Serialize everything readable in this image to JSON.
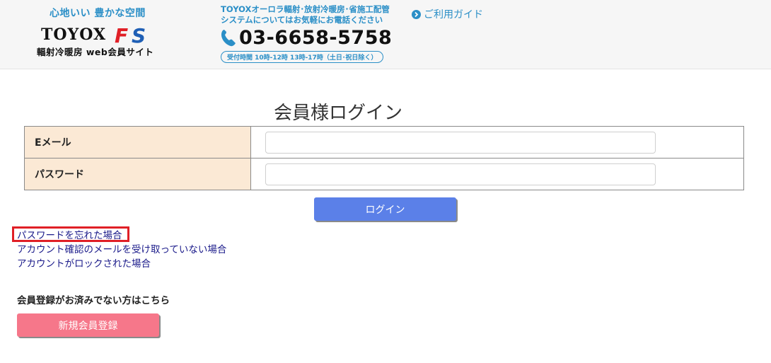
{
  "header": {
    "tagline": "心地いい 豊かな空間",
    "brand": "TOYOX",
    "brand_mark": "FS",
    "subbrand": "輻射冷暖房 web会員サイト",
    "contact_line1": "TOYOXオーロラ輻射･放射冷暖房･省施工配管",
    "contact_line2": "システムについてはお気軽にお電話ください",
    "phone": "03-6658-5758",
    "hours": "受付時間 10時-12時 13時-17時（土日･祝日除く）",
    "guide_label": "ご利用ガイド"
  },
  "login": {
    "title": "会員様ログイン",
    "email_label": "Eメール",
    "email_value": "",
    "password_label": "パスワード",
    "password_value": "",
    "submit_label": "ログイン"
  },
  "links": {
    "forgot_password": "パスワードを忘れた場合",
    "confirmation_not_received": "アカウント確認のメールを受け取っていない場合",
    "account_locked": "アカウントがロックされた場合"
  },
  "register": {
    "heading": "会員登録がお済みでない方はこちら",
    "button_label": "新規会員登録"
  },
  "colors": {
    "accent_blue": "#2b8fc7",
    "login_button": "#5b80e8",
    "register_button": "#f6778a",
    "label_bg": "#fbe9d5",
    "highlight": "#e01f26"
  }
}
